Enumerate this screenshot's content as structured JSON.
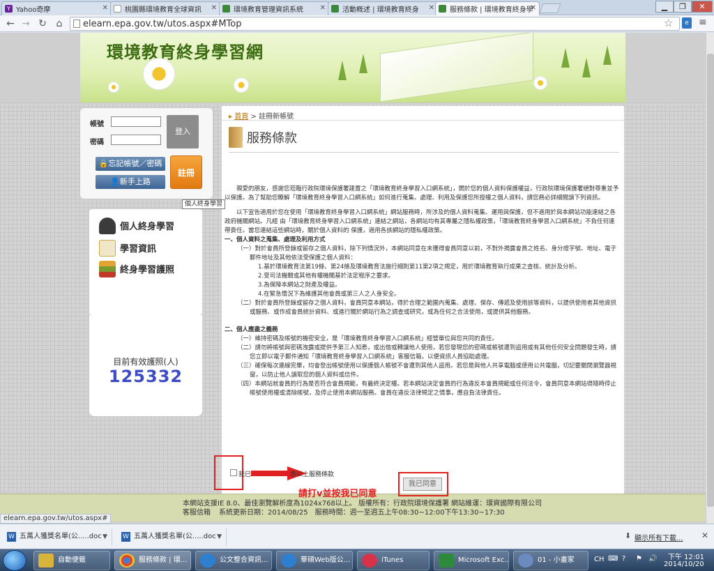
{
  "browser": {
    "tabs": [
      {
        "label": "Yahoo奇摩",
        "icon": "Y",
        "icon_color": "#6b1fa0"
      },
      {
        "label": "桃園縣環境教育全球資訊",
        "icon": "",
        "icon_color": "#aaaaaa"
      },
      {
        "label": "環境教育管理資訊系統",
        "icon": "",
        "icon_color": "#3a8a3a"
      },
      {
        "label": "活動概述 | 環境教育終身",
        "icon": "",
        "icon_color": "#3a8a3a"
      },
      {
        "label": "服務條款 | 環境教育終身學",
        "icon": "",
        "icon_color": "#3a8a3a"
      }
    ],
    "url": "elearn.epa.gov.tw/utos.aspx#MTop",
    "status_url": "elearn.epa.gov.tw/utos.aspx#"
  },
  "site": {
    "title": "環境教育終身學習網"
  },
  "login": {
    "account_label": "帳號",
    "password_label": "密碼",
    "login_button": "登入",
    "forgot_button": "忘記帳號／密碼",
    "newbie_button": "新手上路",
    "register_button": "註冊"
  },
  "menu": {
    "items": [
      {
        "label": "個人終身學習"
      },
      {
        "label": "學習資訊"
      },
      {
        "label": "終身學習護照"
      }
    ],
    "tooltip": "個人終身學習"
  },
  "passport": {
    "label": "目前有效護照(人)",
    "count": "125332"
  },
  "breadcrumb": {
    "home": "首頁",
    "current": "> 註冊新帳號"
  },
  "page": {
    "title": "服務條款",
    "intro1": "親愛的朋友，感謝您蒞臨行政院環境保護署建置之「環境教育終身學習入口網系統」，開於您的個人資料保護權益，行政院環境保護署絕對尊重並予以保護。為了幫助您瞭解「環境教育終身學習入口網系統」如何進行蒐集、處理、利用及保護您所授權之個人資料，請您務必詳細閱讀下列資訊。",
    "intro2": "以下宣告適用於您在使用「環境教育終身學習入口網系統」網站服務時，所涉及的個人資料蒐集、運用與保護，但不適用於與本網站功能連結之各政府機關網站。凡經 由「環境教育終身學習入口網系統」連結之網站，各網站均有其專屬之隱私權政策，「環境教育終身學習入口網系統」不負任何連帶責任。當您連結這些網站時，關於個人資料的 保護，適用各該網站的隱私權政策。",
    "section1": "一、個人資料之蒐集、處理及利用方式",
    "s1_item1": "（一）對於會員所登錄或留存之個人資料，除下列情況外，本網站同意在未獲得會員同意以前，不對外揭露會員之姓名、身分證字號、地址、電子郵件地址及其他依法受保護之個人資料：",
    "s1_sub1": "1.基於環境教育法第19條、第24條及環境教育法施行細則第11第2項之規定，用於環境教育執行成果之查核、統計及分析。",
    "s1_sub2": "2.受司法機關或其他有權機關基於法定程序之要求。",
    "s1_sub3": "3.為保障本網站之財產及權益。",
    "s1_sub4": "4.在緊急情況下為維護其他會員或第三人之人身安全。",
    "s1_item2": "（二）對於會員所登錄或留存之個人資料，會員同意本網站，得於合理之範圍內蒐集、處理、保存、傳遞及使用該等資料，以提供使用者其他資訊或服務、或作成會員統計資料、或進行關於網站行為之調查或研究，或為任何之合法使用，或提供其他服務。",
    "section2": "二、個人應盡之義務",
    "s2_item1": "（一）維持密碼及帳號的機密安全，是「環境教育終身學習入口網系統」經營單位與您共同的責任。",
    "s2_item2": "（二）請勿將帳號與密碼洩露或提供予第三人知悉，或出借或轉讓他人使用，若您發現您的密碼或帳號遭到盜用或有其他任何安全問題發生時，請您立即以電子郵件通知「環境教育終身學習入口網系統」客服信箱，以便資訊人員協助處理。",
    "s2_item3": "（三）確保每次連線完畢，均會登出帳號使用以保護個人帳號不會遭到其他人盜用。若您是與他人共享電腦或使用公共電腦，切記要關閉瀏覽器視窗，以防止他人讀取您的個人資料或信件。",
    "s2_item4": "（四）本網站就會員的行為是否符合會員規範，有最終決定權。若本網站決定會員的行為違反本會員規範或任何法令，會員同意本網站得隨時停止帳號使用權或清除帳號，及停止使用本網站服務。會員在違反法律規定之情事，應自負法律責任。",
    "agree_label_a": "我已",
    "agree_label_b": "意以上服務條款",
    "agree_button": "我已同意",
    "annotation": "請打v並按我已同意"
  },
  "footer": {
    "line1": "本網站支援IE 8.0、最佳瀏覽解析度為1024x768以上。 版權所有：行政院環境保護署 網站維運：環資國際有限公司",
    "line2_left": "客服信箱",
    "line2": "系統更新日期：2014/08/25　服務時間：週一至週五上午08:30~12:00下午13:30~17:30"
  },
  "downloads": {
    "items": [
      {
        "label": "五萬人獲獎名單(公.....doc"
      },
      {
        "label": "五萬人獲獎名單(公.....doc"
      }
    ],
    "show_all": "顯示所有下載...",
    "doc_icon": "W"
  },
  "taskbar": {
    "items": [
      {
        "label": "自動便籤",
        "color": "#d9b43a"
      },
      {
        "label": "服務條款 | 環...",
        "color": "#e04a2a"
      },
      {
        "label": "公文整合資訊...",
        "color": "#2f7fd0"
      },
      {
        "label": "華碩Web版公...",
        "color": "#2f7fd0"
      },
      {
        "label": "iTunes",
        "color": "#d8324a"
      },
      {
        "label": "Microsoft Exc...",
        "color": "#2d8a3d"
      },
      {
        "label": "01 - 小畫家",
        "color": "#6a8ac0"
      }
    ],
    "lang": "CH",
    "time": "下午 12:01",
    "date": "2014/10/20"
  }
}
